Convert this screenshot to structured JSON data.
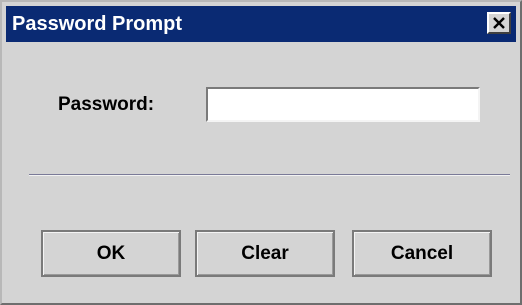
{
  "window": {
    "title": "Password Prompt",
    "close_icon": "close-x-icon"
  },
  "form": {
    "password_label": "Password:",
    "password_value": ""
  },
  "buttons": {
    "ok": "OK",
    "clear": "Clear",
    "cancel": "Cancel"
  },
  "colors": {
    "titlebar": "#0a2a73",
    "dialog_background": "#d4d4d4"
  }
}
